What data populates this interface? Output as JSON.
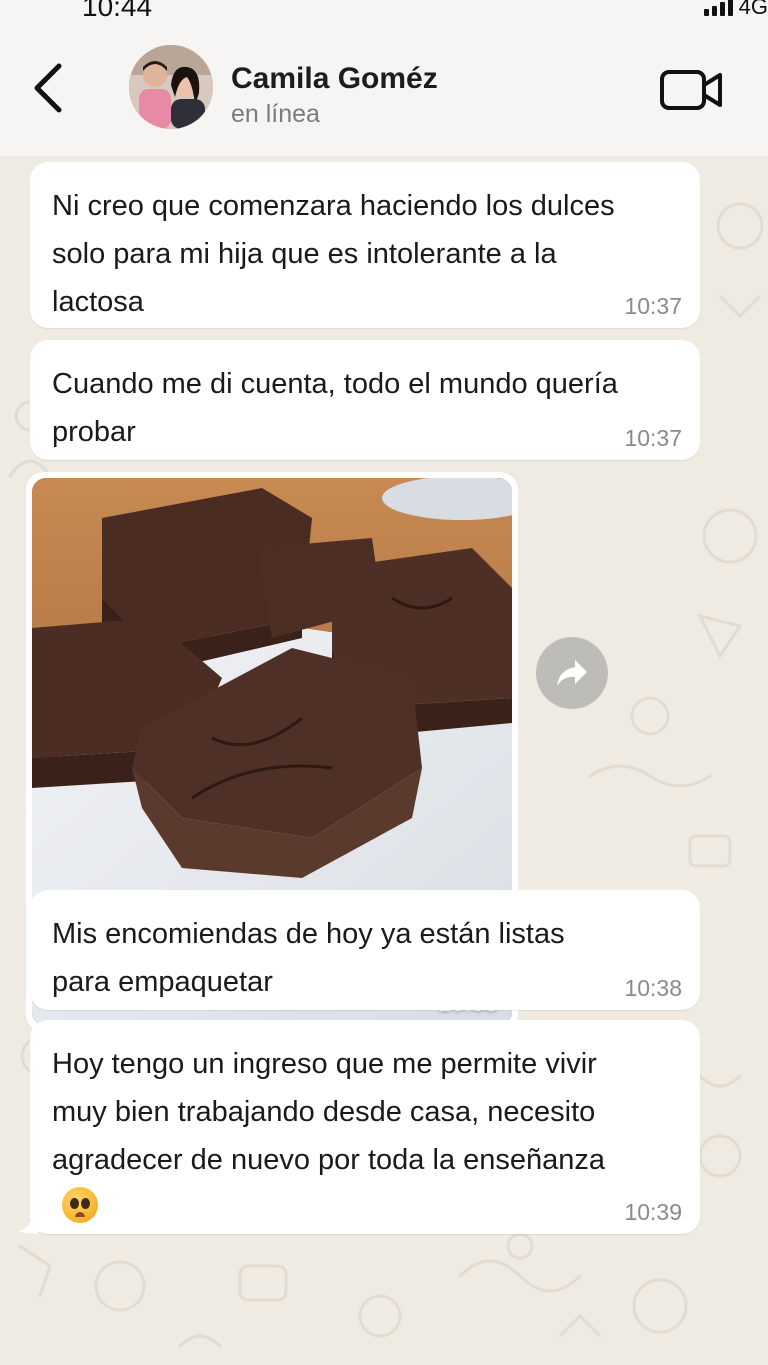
{
  "status_bar": {
    "time": "10:44",
    "network": "4G"
  },
  "header": {
    "back_icon": "chevron-left-icon",
    "contact_name": "Camila Goméz",
    "contact_status": "en línea",
    "video_icon": "video-camera-icon"
  },
  "messages": [
    {
      "type": "text",
      "text": "Ni creo que comenzara haciendo los dulces solo para mi hija que es intolerante a la lactosa",
      "time": "10:37"
    },
    {
      "type": "text",
      "text": "Cuando me di cuenta, todo el mundo quería probar",
      "time": "10:37"
    },
    {
      "type": "image",
      "description_icon": "brownies-photo",
      "time": "10:38",
      "forward_icon": "forward-arrow-icon"
    },
    {
      "type": "text",
      "text": "Mis encomiendas de hoy ya están listas para empaquetar",
      "time": "10:38"
    },
    {
      "type": "text",
      "text": "Hoy tengo un ingreso que me permite vivir muy bien trabajando desde casa, necesito agradecer de nuevo por toda la enseñanza",
      "emoji": "pleading-face-emoji",
      "time": "10:39"
    }
  ],
  "colors": {
    "chat_background": "#efeae2",
    "header_background": "#f6f5f3",
    "bubble": "#ffffff",
    "timestamp": "#8a8a8a"
  }
}
